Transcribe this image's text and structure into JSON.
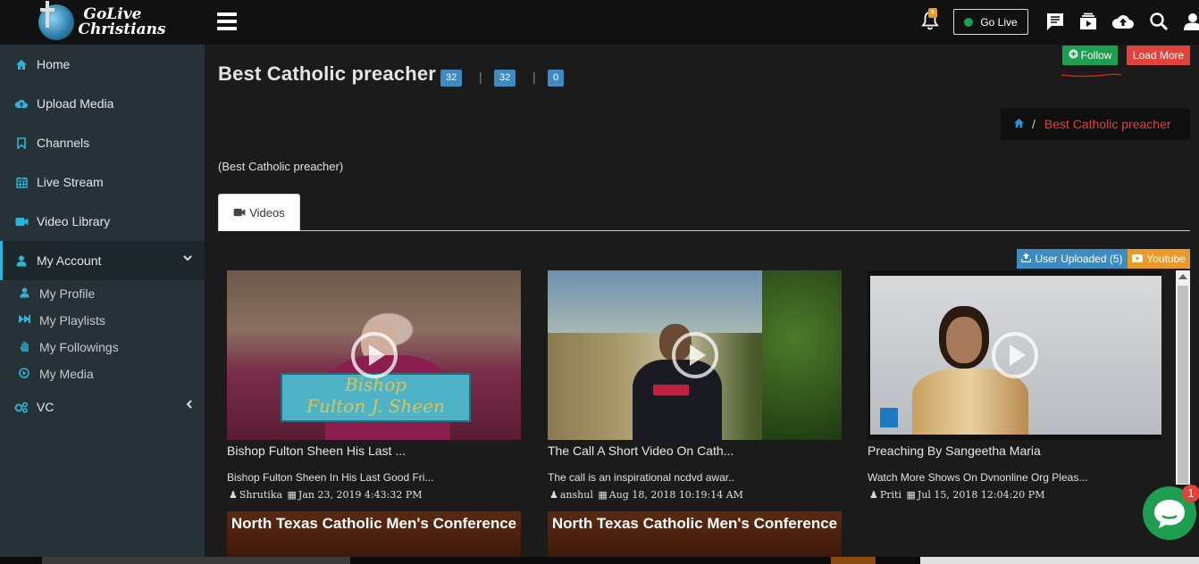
{
  "brand": {
    "line1": "GoLive",
    "line2": "Christians"
  },
  "sidebar": {
    "items": [
      {
        "label": "Home",
        "icon": "home-icon"
      },
      {
        "label": "Upload Media",
        "icon": "cloud-upload-icon"
      },
      {
        "label": "Channels",
        "icon": "bookmark-icon"
      },
      {
        "label": "Live Stream",
        "icon": "calendar-icon"
      },
      {
        "label": "Video Library",
        "icon": "video-camera-icon"
      },
      {
        "label": "My Account",
        "icon": "user-icon"
      }
    ],
    "sub_items": [
      {
        "label": "My Profile",
        "icon": "user-icon"
      },
      {
        "label": "My Playlists",
        "icon": "playlist-icon"
      },
      {
        "label": "My Followings",
        "icon": "hand-icon"
      },
      {
        "label": "My Media",
        "icon": "play-circle-icon"
      }
    ],
    "vc_label": "VC"
  },
  "topbar": {
    "notification_count": "5",
    "golive_label": "Go Live"
  },
  "page": {
    "title": "Best Catholic preacher",
    "counts": [
      "32",
      "32",
      "0"
    ],
    "follow_label": "Follow",
    "load_more_label": "Load More",
    "breadcrumb_current": "Best Catholic preacher",
    "description": "(Best Catholic preacher)",
    "tab_videos": "Videos",
    "source_user": "User Uploaded (5)",
    "source_youtube": "Youtube"
  },
  "videos": [
    {
      "title": "Bishop Fulton Sheen His Last ...",
      "desc": "Bishop Fulton Sheen In His Last Good Fri...",
      "user": "Shrutika",
      "date": "Jan 23, 2019 4:43:32 PM",
      "overlay_line1": "Bishop",
      "overlay_line2": "Fulton J. Sheen"
    },
    {
      "title": "The Call A Short Video On Cath...",
      "desc": "The call is an inspirational ncdvd awar..",
      "user": "anshul",
      "date": "Aug 18, 2018 10:19:14 AM"
    },
    {
      "title": "Preaching By Sangeetha Maria",
      "desc": "Watch More Shows On Dvnonline Org Pleas...",
      "user": "Priti",
      "date": "Jul 15, 2018 12:04:20 PM"
    }
  ],
  "next_videos": [
    {
      "banner": "North Texas Catholic Men's Conference"
    },
    {
      "banner": "North Texas Catholic Men's Conference"
    }
  ],
  "chat": {
    "badge": "1"
  },
  "colors": {
    "accent": "#2bb5d8",
    "green": "#1e9e4f",
    "red": "#e0433b",
    "blue": "#3d8bc0",
    "orange": "#e89a2b"
  }
}
